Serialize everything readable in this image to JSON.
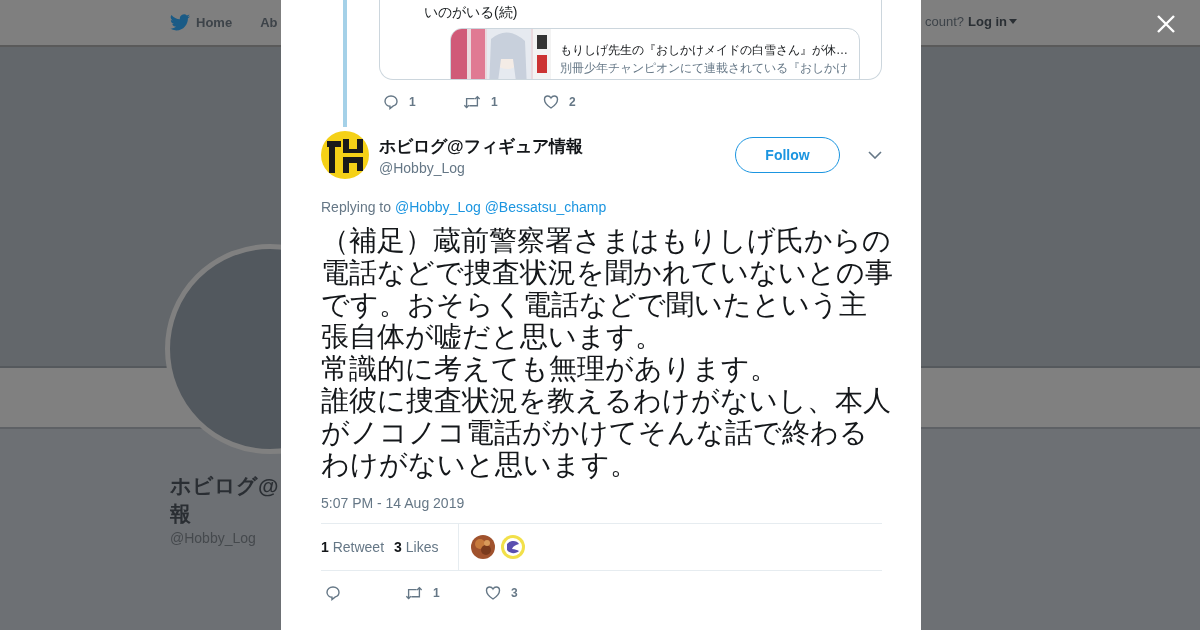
{
  "background_page": {
    "nav": {
      "home": "Home",
      "about": "Ab",
      "account_prompt": "count?",
      "login": "Log in"
    },
    "profile": {
      "name_lines": [
        "ホビログ@",
        "報"
      ],
      "handle": "@Hobby_Log"
    }
  },
  "parent_tweet": {
    "text": "いのがいる(続)",
    "link_card": {
      "title": "もりしげ先生の『おしかけメイドの白雪さん』が休…",
      "description": "別冊少年チャンピオンにて連載されている『おしかけ"
    },
    "actions": {
      "replies": "1",
      "retweets": "1",
      "likes": "2"
    }
  },
  "tweet": {
    "name": "ホビログ@フィギュア情報",
    "handle": "@Hobby_Log",
    "follow": "Follow",
    "replying_label": "Replying to",
    "replying_to": [
      "@Hobby_Log",
      "@Bessatsu_champ"
    ],
    "text_paragraphs": [
      "（補足）蔵前警察署さまはもりしげ氏からの電話などで捜査状況を聞かれていないとの事です。おそらく電話などで聞いたという主張自体が嘘だと思います。",
      "常識的に考えても無理があります。",
      "誰彼に捜査状況を教えるわけがないし、本人がノコノコ電話がかけてそんな話で終わるわけがないと思います。"
    ],
    "timestamp": "5:07 PM - 14 Aug 2019",
    "stats": [
      {
        "count": "1",
        "label": "Retweet"
      },
      {
        "count": "3",
        "label": "Likes"
      }
    ],
    "actions": {
      "retweets": "1",
      "likes": "3"
    }
  }
}
